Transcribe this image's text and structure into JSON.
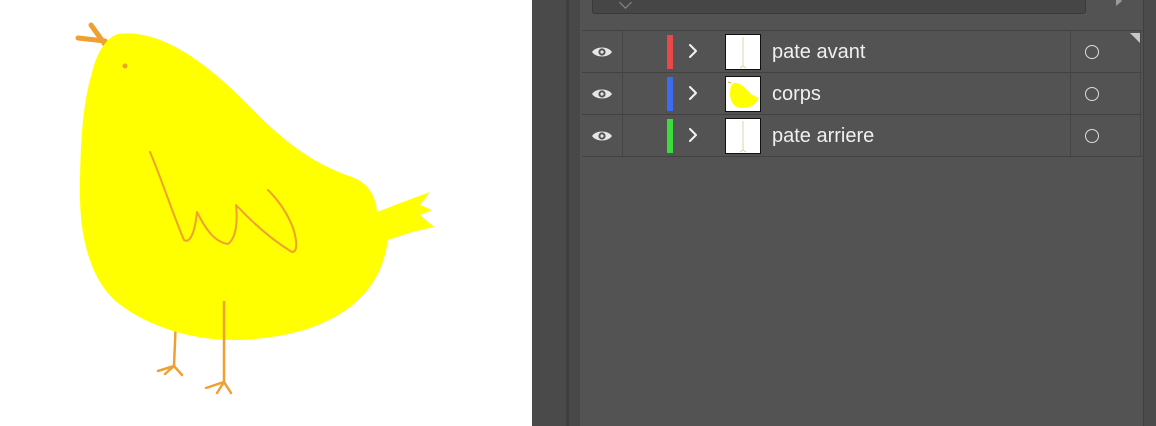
{
  "artboard": {
    "background": "#ffffff",
    "chick": {
      "body_color": "#ffff00",
      "line_color": "#f0a030"
    }
  },
  "panel": {
    "background": "#535353",
    "layers": [
      {
        "name": "pate avant",
        "color": "#e84848",
        "visible": true,
        "thumbnail": "leg"
      },
      {
        "name": "corps",
        "color": "#3d6cf0",
        "visible": true,
        "thumbnail": "body"
      },
      {
        "name": "pate arriere",
        "color": "#3ddc3d",
        "visible": true,
        "thumbnail": "leg"
      }
    ]
  },
  "icons": {
    "visibility": "eye-icon",
    "expand": "chevron-right-icon",
    "target": "circle-target-icon"
  }
}
